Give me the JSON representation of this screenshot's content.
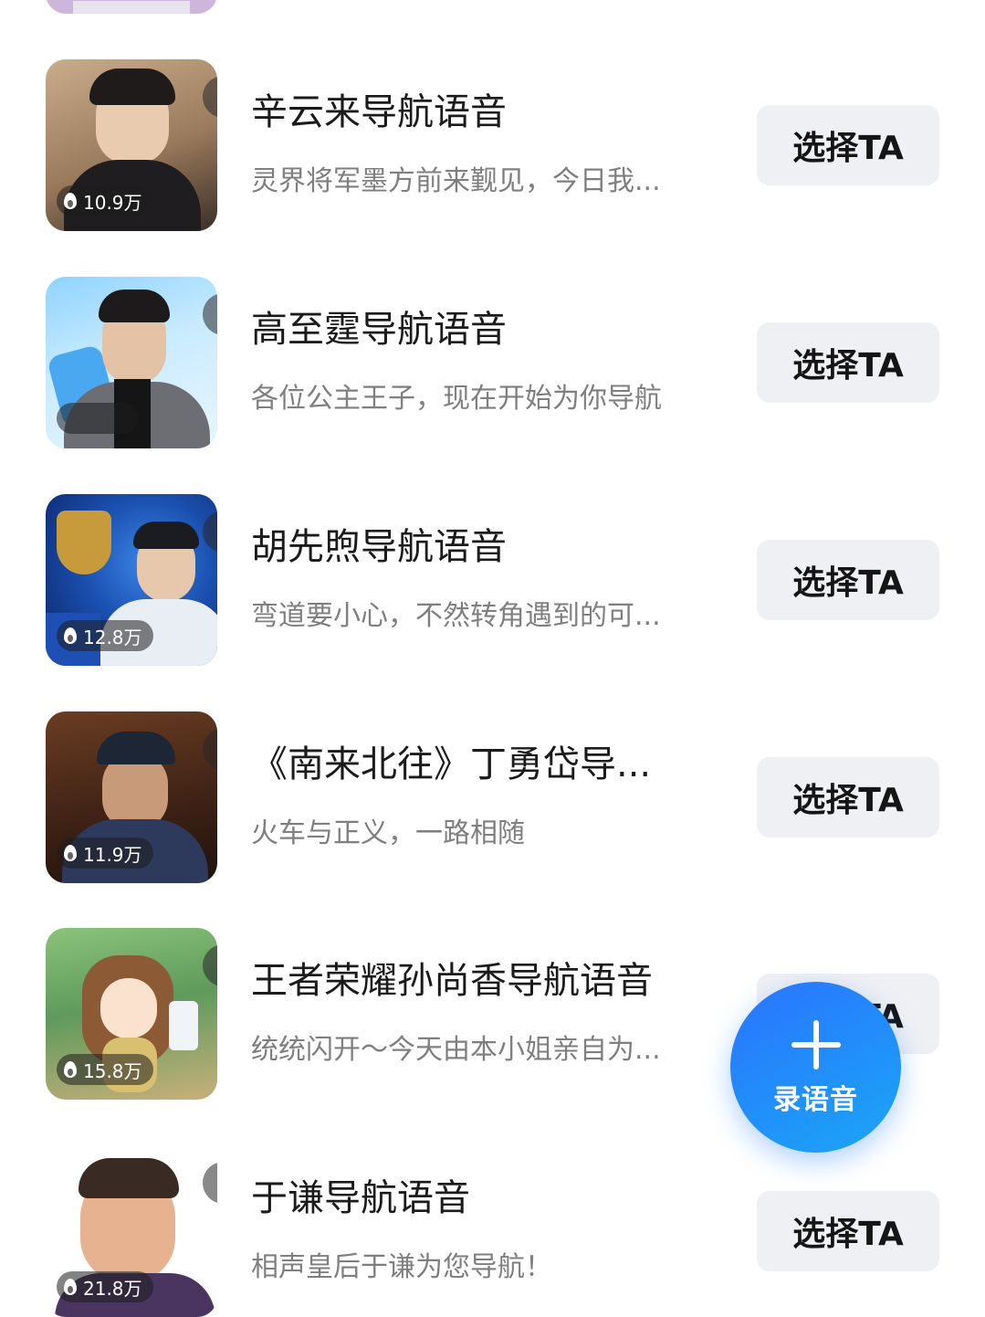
{
  "list": [
    {
      "title": "辛云来导航语音",
      "desc": "灵界将军墨方前来觐见，今日我...",
      "heat": "10.9万",
      "button": "选择TA",
      "thumb_colors": [
        "#5a4a3c",
        "#c8a887"
      ]
    },
    {
      "title": "高至霆导航语音",
      "desc": "各位公主王子，现在开始为你导航",
      "heat": "",
      "button": "选择TA",
      "thumb_colors": [
        "#6fc3ff",
        "#d9efff"
      ]
    },
    {
      "title": "胡先煦导航语音",
      "desc": "弯道要小心，不然转角遇到的可...",
      "heat": "12.8万",
      "button": "选择TA",
      "thumb_colors": [
        "#0c2a78",
        "#2f72d8"
      ]
    },
    {
      "title": "《南来北往》丁勇岱导...",
      "desc": "火车与正义，一路相随",
      "heat": "11.9万",
      "button": "选择TA",
      "thumb_colors": [
        "#3a1f12",
        "#8a5a3a"
      ]
    },
    {
      "title": "王者荣耀孙尚香导航语音",
      "desc": "统统闪开～今天由本小姐亲自为...",
      "heat": "15.8万",
      "button": "选择TA",
      "thumb_colors": [
        "#6aa56a",
        "#d8c28a"
      ]
    },
    {
      "title": "于谦导航语音",
      "desc": "相声皇后于谦为您导航！",
      "heat": "21.8万",
      "button": "选择TA",
      "thumb_colors": [
        "#ffffff",
        "#f3ece6"
      ]
    }
  ],
  "fab": {
    "label": "录语音",
    "icon": "plus-icon"
  },
  "colors": {
    "accent": "#2a74ff",
    "button_bg": "#eff0f3",
    "desc_text": "#7f7f7f"
  }
}
